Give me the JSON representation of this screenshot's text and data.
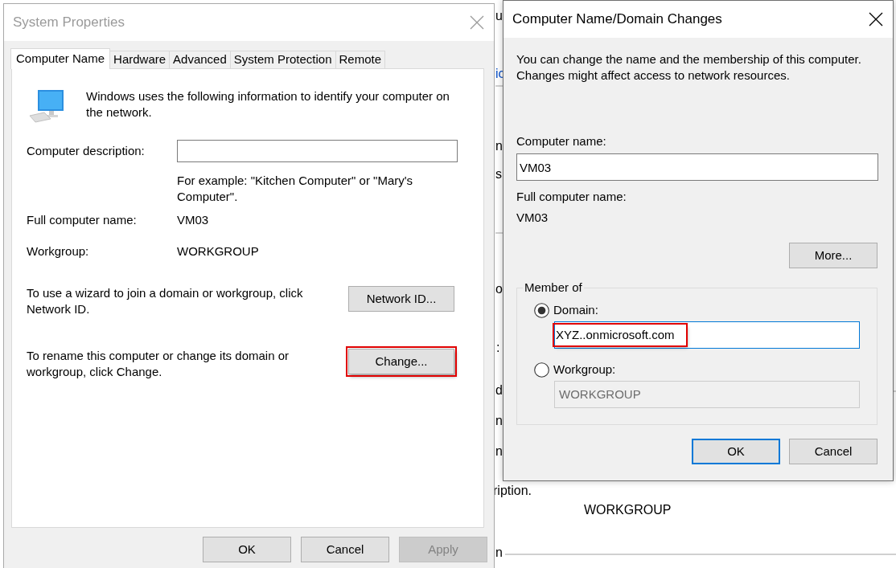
{
  "background": {
    "fragments": [
      {
        "text": "u",
        "kind": "text"
      },
      {
        "text": "ic",
        "kind": "link"
      },
      {
        "text": "n",
        "kind": "text"
      },
      {
        "text": "s",
        "kind": "text"
      },
      {
        "text": "o",
        "kind": "text"
      },
      {
        "text": ":",
        "kind": "text"
      },
      {
        "text": "d",
        "kind": "text"
      },
      {
        "text": "n",
        "kind": "text"
      },
      {
        "text": "n",
        "kind": "text"
      },
      {
        "text": "ription.",
        "kind": "text"
      },
      {
        "text": "WORKGROUP",
        "kind": "text"
      },
      {
        "text": "n",
        "kind": "text"
      }
    ]
  },
  "system_properties": {
    "title": "System Properties",
    "active": false,
    "tabs": [
      {
        "label": "Computer Name",
        "selected": true
      },
      {
        "label": "Hardware",
        "selected": false
      },
      {
        "label": "Advanced",
        "selected": false
      },
      {
        "label": "System Protection",
        "selected": false
      },
      {
        "label": "Remote",
        "selected": false
      }
    ],
    "intro": "Windows uses the following information to identify your computer on the network.",
    "description": {
      "label": "Computer description:"
    },
    "example": "For example: \"Kitchen Computer\" or \"Mary's Computer\".",
    "fields": [
      {
        "label": "Full computer name:",
        "value": "VM03"
      },
      {
        "label": "Workgroup:",
        "value": "WORKGROUP"
      }
    ],
    "actions": [
      {
        "text": "To use a wizard to join a domain or workgroup, click Network ID.",
        "button": "Network ID...",
        "highlighted": false
      },
      {
        "text": "To rename this computer or change its domain or workgroup, click Change.",
        "button": "Change...",
        "highlighted": true
      }
    ],
    "buttons": [
      {
        "label": "OK",
        "disabled": false
      },
      {
        "label": "Cancel",
        "disabled": false
      },
      {
        "label": "Apply",
        "disabled": true
      }
    ]
  },
  "dialog": {
    "title": "Computer Name/Domain Changes",
    "active": true,
    "intro": "You can change the name and the membership of this computer. Changes might affect access to network resources.",
    "computer_name": {
      "label": "Computer name:",
      "value": "VM03"
    },
    "full_name": {
      "label": "Full computer name:",
      "value": "VM03"
    },
    "more_button": "More...",
    "member_of": {
      "legend": "Member of",
      "options": [
        {
          "label": "Domain:",
          "selected": true,
          "value": "XYZ..onmicrosoft.com",
          "highlighted": true,
          "focused": true
        },
        {
          "label": "Workgroup:",
          "selected": false,
          "value": "WORKGROUP",
          "highlighted": false,
          "focused": false
        }
      ]
    },
    "buttons": [
      {
        "label": "OK",
        "default": true
      },
      {
        "label": "Cancel",
        "default": false
      }
    ]
  }
}
